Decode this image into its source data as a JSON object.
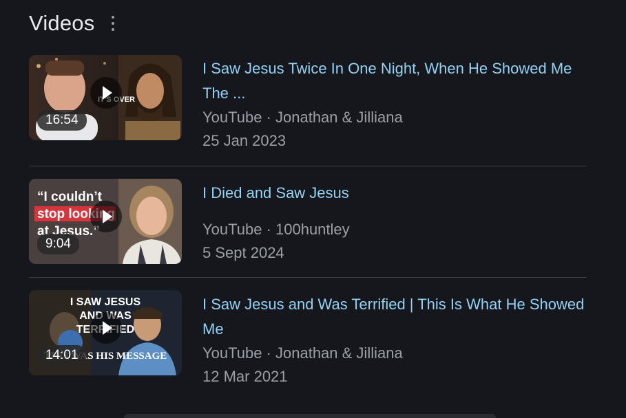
{
  "header": {
    "title": "Videos"
  },
  "videos": [
    {
      "title": "I Saw Jesus Twice In One Night, When He Showed Me The ...",
      "source": "YouTube · Jonathan & Jilliana",
      "date": "25 Jan 2023",
      "duration": "16:54",
      "thumb_text": "IT'S OVER"
    },
    {
      "title": "I Died and Saw Jesus",
      "source": "YouTube · 100huntley",
      "date": "5 Sept 2024",
      "duration": "9:04",
      "thumb_text_1": "“I couldn’t",
      "thumb_text_2": "stop looking",
      "thumb_text_3": "at Jesus.”"
    },
    {
      "title": "I Saw Jesus and Was Terrified | This Is What He Showed Me",
      "source": "YouTube · Jonathan & Jilliana",
      "date": "12 Mar 2021",
      "duration": "14:01",
      "thumb_text_1": "I SAW JESUS",
      "thumb_text_2": "AND WAS",
      "thumb_text_3": "TERRIFIED",
      "thumb_text_4": "THIS WAS HIS MESSAGE"
    }
  ]
}
